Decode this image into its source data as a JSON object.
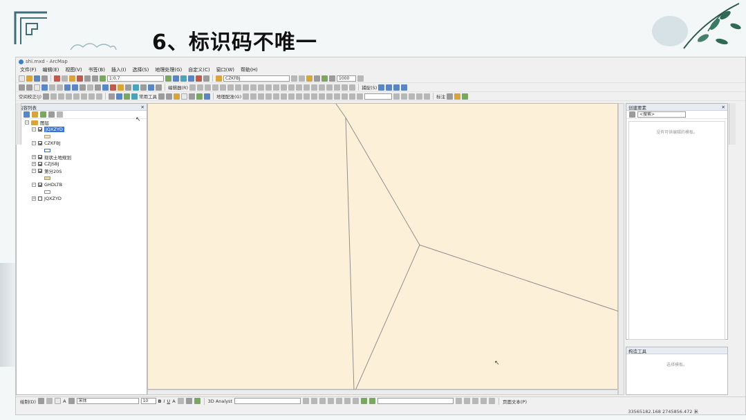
{
  "slide": {
    "title": "6、标识码不唯一"
  },
  "window": {
    "title": "shi.mxd - ArcMap"
  },
  "menu": [
    "文件(F)",
    "编辑(E)",
    "视图(V)",
    "书签(B)",
    "插入(I)",
    "选择(S)",
    "地理处理(G)",
    "自定义(C)",
    "窗口(W)",
    "帮助(H)"
  ],
  "toolbar": {
    "scale": "1:0.7",
    "layer_select": "CZKFBJ",
    "value_box": "1000",
    "editor_label": "编辑器(R)",
    "georef_label": "地理配准(G)",
    "spatial_adjust": "空间校正(J)",
    "geometry_label": "常用工具",
    "snap_label": "捕捉(S)",
    "layout_label": "标注"
  },
  "toc": {
    "title": "内容列表",
    "root": "图层",
    "layers": [
      {
        "name": "JQXZYD",
        "checked": true,
        "expanded": true,
        "selected": true,
        "swatch": "#f6e3bd",
        "swatch_border": "#b5a27a"
      },
      {
        "name": "CZKFBJ",
        "checked": true,
        "expanded": true,
        "selected": false,
        "swatch": "#ffffff",
        "swatch_border": "#2b6fd6"
      },
      {
        "name": "现状土地规划",
        "checked": true,
        "expanded": false,
        "selected": false
      },
      {
        "name": "CZJSBJ",
        "checked": true,
        "expanded": false,
        "selected": false
      },
      {
        "name": "第分20S",
        "checked": true,
        "expanded": true,
        "selected": false,
        "swatch": "#e8d7a8",
        "swatch_border": "#a99463"
      },
      {
        "name": "GHDLTB",
        "checked": true,
        "expanded": true,
        "selected": false,
        "swatch": "#ffffff",
        "swatch_border": "#8a8a8a"
      },
      {
        "name": "JQXZYD",
        "checked": false,
        "expanded": false,
        "selected": false
      }
    ]
  },
  "right_panel": {
    "title": "创建要素",
    "search_placeholder": "<搜索>",
    "hint": "没有可供编辑的模板。"
  },
  "right_panel2": {
    "title": "构造工具",
    "hint": "选择模板。"
  },
  "draw_toolbar": {
    "label": "绘制(D)",
    "font": "宋体",
    "font_size": "10",
    "analyst": "3D Analyst",
    "layout_text": "页面文本(P)"
  },
  "status": {
    "coordinates": "33565182.168  2745856.472 米"
  },
  "colors": {
    "map_background": "#fcf1d8",
    "boundary_line": "#8f8f8f",
    "selection": "#3875d7"
  }
}
